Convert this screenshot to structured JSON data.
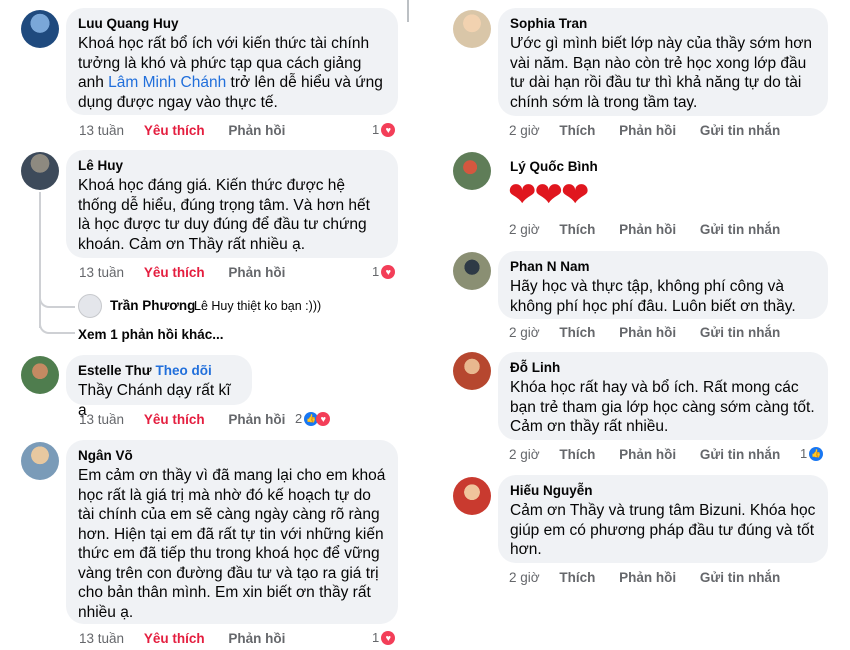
{
  "labels": {
    "like": "Thích",
    "liked": "Yêu thích",
    "reply": "Phản hồi",
    "message": "Gửi tin nhắn",
    "follow": "Theo dõi"
  },
  "left": [
    {
      "name": "Luu Quang Huy",
      "time": "13 tuần",
      "text_before": "Khoá học rất bổ ích với kiến thức tài chính tưởng là khó và phức tạp qua cách giảng anh ",
      "link": "Lâm Minh Chánh",
      "text_after": " trở lên dễ hiểu và ứng dụng được ngay vào thực tế.",
      "reaction_count": "1"
    },
    {
      "name": "Lê Huy",
      "time": "13 tuần",
      "text": "Khoá học đáng giá. Kiến thức được hệ thống dễ hiểu, đúng trọng tâm. Và hơn hết là học được tư duy đúng để đầu tư chứng khoán. Cảm ơn Thầy rất nhiều ạ.",
      "reaction_count": "1",
      "reply": {
        "name": "Trần Phương",
        "text": "Lê Huy thiệt ko bạn :)))"
      },
      "more_replies": "Xem 1 phản hồi khác..."
    },
    {
      "name": "Estelle Thư",
      "time": "13 tuần",
      "text": "Thầy Chánh dạy rất kĩ ạ",
      "reaction_count": "2"
    },
    {
      "name": "Ngân Võ",
      "time": "13 tuần",
      "text": "Em cảm ơn thầy vì đã mang lại cho em khoá học rất là giá trị mà nhờ đó kế hoạch tự do tài chính của em sẽ càng ngày càng rõ ràng hơn. Hiện tại em đã rất tự tin với những kiến thức em đã tiếp thu trong khoá học để vững vàng trên con đường đầu tư và tạo ra giá trị cho bản thân mình. Em xin biết ơn thầy rất nhiều ạ.",
      "reaction_count": "1"
    }
  ],
  "right": [
    {
      "name": "Sophia Tran",
      "time": "2 giờ",
      "text": "Ước gì mình biết lớp này của thầy sớm hơn vài năm. Bạn nào còn trẻ học xong lớp đầu tư dài hạn rồi đầu tư thì khả năng tự do tài chính sớm là trong tầm tay."
    },
    {
      "name": "Lý Quốc Bình",
      "time": "2 giờ",
      "emoji": "❤❤❤"
    },
    {
      "name": "Phan N Nam",
      "time": "2 giờ",
      "text": "Hãy học và thực tập, không phí công và không phí học phí đâu. Luôn biết ơn thầy."
    },
    {
      "name": "Đỗ Linh",
      "time": "2 giờ",
      "text": "Khóa học rất hay và bổ ích. Rất mong các bạn trẻ tham gia lớp học càng sớm càng tốt. Cảm ơn thầy rất nhiều.",
      "reaction_count": "1"
    },
    {
      "name": "Hiếu Nguyễn",
      "time": "2 giờ",
      "text": "Cảm ơn Thầy và trung tâm Bizuni. Khóa học giúp em có phương pháp đầu tư đúng và tốt hơn."
    }
  ],
  "colors": {
    "link": "#216fdb",
    "liked": "#e41e3f",
    "bubble": "#f0f2f5",
    "meta": "#65676b"
  }
}
